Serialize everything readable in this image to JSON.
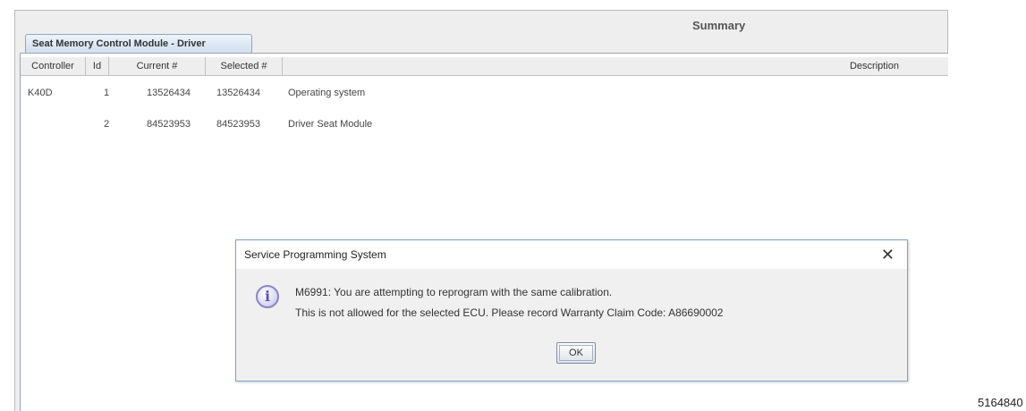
{
  "window": {
    "summary_title": "Summary",
    "tab_label": "Seat Memory Control Module - Driver"
  },
  "table": {
    "columns": [
      "Controller",
      "Id",
      "Current #",
      "Selected #",
      "Description"
    ],
    "rows": [
      {
        "controller": "K40D",
        "id": "1",
        "current": "13526434",
        "selected": "13526434",
        "description": "Operating system"
      },
      {
        "controller": "",
        "id": "2",
        "current": "84523953",
        "selected": "84523953",
        "description": "Driver Seat Module"
      }
    ]
  },
  "dialog": {
    "title": "Service Programming System",
    "close_glyph": "✕",
    "icon": "info-icon",
    "icon_glyph": "i",
    "message_line1": "M6991: You are attempting to reprogram with the same calibration.",
    "message_line2": "This is not allowed for the selected ECU. Please record Warranty Claim Code: A86690002",
    "ok_label": "OK"
  },
  "image_id_label": "5164840"
}
